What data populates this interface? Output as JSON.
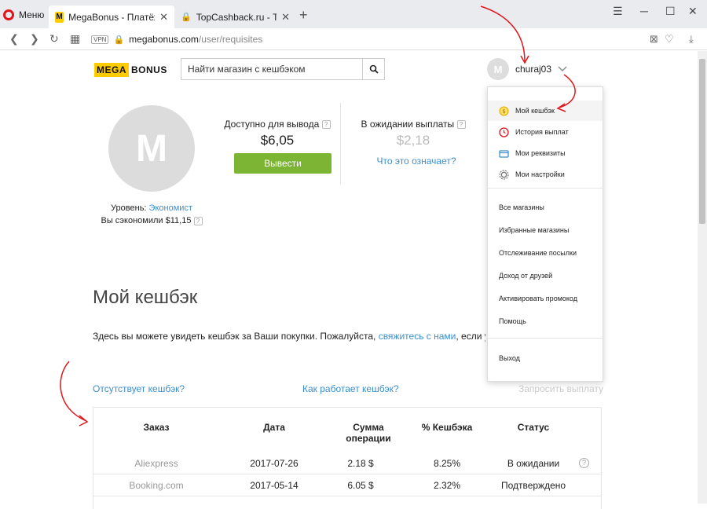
{
  "browser": {
    "menu_label": "Меню",
    "tabs": [
      {
        "title": "MegaBonus - Платёжные",
        "favicon": "M"
      },
      {
        "title": "TopCashback.ru - Топ луч"
      }
    ],
    "url_host": "megabonus.com",
    "url_path": "/user/requisites",
    "vpn": "VPN"
  },
  "header": {
    "logo_mega": "MEGA",
    "logo_bonus": "BONUS",
    "search_placeholder": "Найти магазин с кешбэком",
    "avatar_letter": "M",
    "username": "churaj03"
  },
  "profile": {
    "avatar_letter": "M",
    "level_label": "Уровень:",
    "level_value": "Экономист",
    "saved_label": "Вы сэкономили $11,15"
  },
  "balance": {
    "available_label": "Доступно для вывода",
    "available_value": "$6,05",
    "withdraw_button": "Вывести",
    "pending_label": "В ожидании выплаты",
    "pending_value": "$2,18",
    "what_means_link": "Что это означает?"
  },
  "cashback_section": {
    "title": "Мой кешбэк",
    "description": "Здесь вы можете увидеть кешбэк за Ваши покупки. Пожалуйста,",
    "contact_link": "свяжитесь с нами",
    "description_tail": ", если у",
    "missing_link": "Отсутствует кешбэк?",
    "how_link": "Как работает кешбэк?",
    "request_payment": "Запросить выплату"
  },
  "table": {
    "headers": [
      "Заказ",
      "Дата",
      "Сумма операции",
      "% Кешбэка",
      "Статус"
    ],
    "header_sum_line1": "Сумма",
    "header_sum_line2": "операции",
    "rows": [
      {
        "store": "Aliexpress",
        "date": "2017-07-26",
        "sum": "2.18 $",
        "percent": "8.25%",
        "status": "В ожидании"
      },
      {
        "store": "Booking.com",
        "date": "2017-05-14",
        "sum": "6.05 $",
        "percent": "2.32%",
        "status": "Подтверждено"
      }
    ]
  },
  "dropdown": {
    "my_cashback": "Мой кешбэк",
    "payment_history": "История выплат",
    "my_requisites": "Мои реквизиты",
    "my_settings": "Мои настройки",
    "all_stores": "Все магазины",
    "favorite_stores": "Избранные магазины",
    "track_parcel": "Отслеживание посылки",
    "friends_income": "Доход от друзей",
    "activate_promo": "Активировать промокод",
    "help": "Помощь",
    "logout": "Выход"
  },
  "colors": {
    "accent_yellow": "#ffcc00",
    "button_green": "#7bb533",
    "link_blue": "#3b8fcf",
    "annotation_red": "#e0161b"
  }
}
